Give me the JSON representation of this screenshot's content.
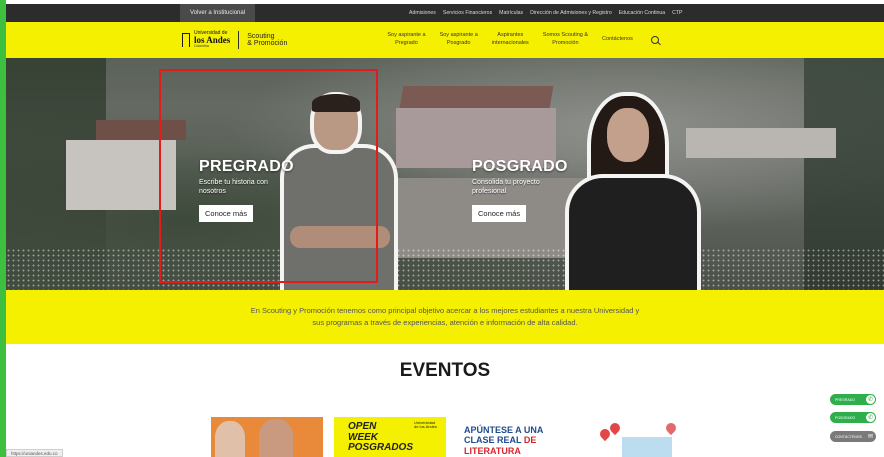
{
  "topbar": {
    "back_label": "Volver a Institucional",
    "links": [
      "Admisiones",
      "Servicios Financieros",
      "Matrículas",
      "Dirección de Admisiones y Registro",
      "Educación Continua",
      "CTP"
    ]
  },
  "header": {
    "logo_line1": "Universidad de",
    "logo_line2": "los Andes",
    "logo_line3": "Colombia",
    "section_title_1": "Scouting",
    "section_title_2": "& Promoción",
    "nav": [
      "Soy aspirante a\nPregrado",
      "Soy aspirante a\nPosgrado",
      "Aspirantes\ninternacionales",
      "Somos Scouting &\nPromoción",
      "Contáctenos"
    ]
  },
  "hero": {
    "pregrado": {
      "title": "PREGRADO",
      "subtitle": "Escribe tu historia con nosotros",
      "button": "Conoce más"
    },
    "posgrado": {
      "title": "POSGRADO",
      "subtitle": "Consolida tu proyecto profesional",
      "button": "Conoce más"
    }
  },
  "mission": {
    "text": "En Scouting y Promoción tenemos como principal objetivo acercar a los mejores estudiantes a nuestra Universidad y sus programas a través de experiencias, atención e información de alta calidad."
  },
  "events": {
    "title": "EVENTOS",
    "card2_line1": "OPEN",
    "card2_line2": "WEEK",
    "card2_line3": "POSGRADOS",
    "card2_logo": "Universidad de los Andes",
    "card3_line1": "APÚNTESE A UNA",
    "card3_line2a": "CLASE REAL ",
    "card3_line2b": "DE",
    "card3_line3": "LITERATURA"
  },
  "floating": {
    "btn1": "PREGRADO",
    "btn2": "POSGRADO",
    "btn3": "CONTÁCTENOS"
  },
  "status_url": "https://uniandes.edu.co",
  "colors": {
    "brand_yellow": "#f5f000",
    "topbar": "#2c2c2c",
    "highlight": "#e21b1b",
    "whatsapp_green": "#2fae4c"
  }
}
